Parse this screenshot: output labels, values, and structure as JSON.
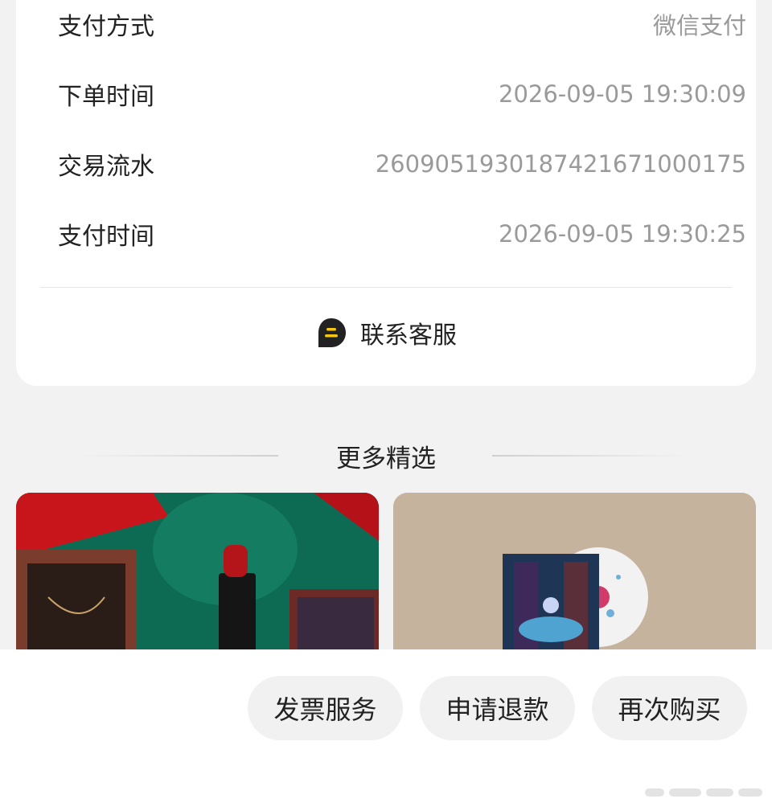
{
  "order_info": {
    "rows": [
      {
        "label": "支付方式",
        "value": "微信支付"
      },
      {
        "label": "下单时间",
        "value": "2026-09-05 19:30:09"
      },
      {
        "label": "交易流水",
        "value": "2609051930187421671000175"
      },
      {
        "label": "支付时间",
        "value": "2026-09-05 19:30:25"
      }
    ],
    "contact_service": {
      "label": "联系客服",
      "icon": "chat-bubble-icon"
    }
  },
  "more_picks": {
    "title": "更多精选",
    "products": [
      {
        "image": "lipstick-gift-set-image"
      },
      {
        "image": "vinyl-record-image"
      }
    ]
  },
  "actions": {
    "invoice": "发票服务",
    "refund": "申请退款",
    "rebuy": "再次购买"
  },
  "colors": {
    "background": "#f2f2f2",
    "card": "#ffffff",
    "value_text": "#9a9a9a",
    "service_icon": "#222222",
    "service_icon_accent": "#f5c518"
  }
}
